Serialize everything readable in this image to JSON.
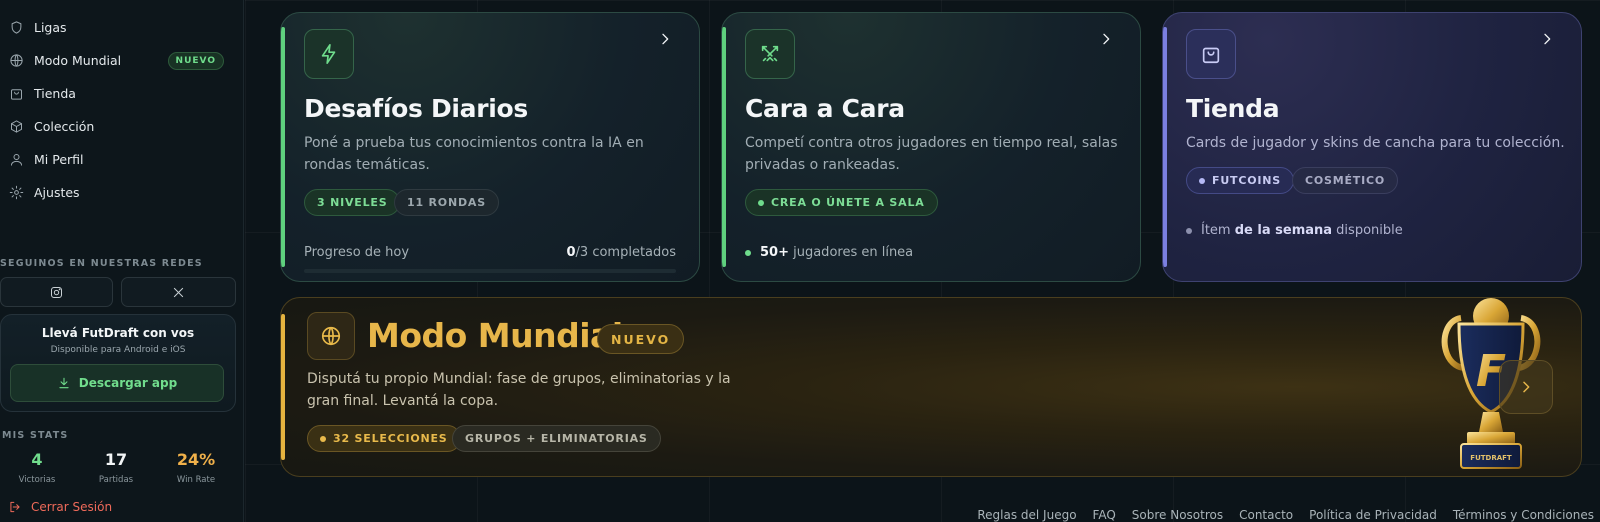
{
  "sidebar": {
    "items": [
      {
        "label": "Ligas",
        "icon": "shield-icon"
      },
      {
        "label": "Modo Mundial",
        "icon": "globe-icon",
        "badge": "NUEVO"
      },
      {
        "label": "Tienda",
        "icon": "shopping-bag-icon"
      },
      {
        "label": "Colección",
        "icon": "box-icon"
      },
      {
        "label": "Mi Perfil",
        "icon": "user-icon"
      },
      {
        "label": "Ajustes",
        "icon": "gear-icon"
      }
    ],
    "social_title": "SEGUINOS EN NUESTRAS REDES",
    "app_card": {
      "title": "Llevá FutDraft con vos",
      "subtitle": "Disponible para Android e iOS",
      "button": "Descargar app"
    },
    "stats_title": "MIS STATS",
    "stats": [
      {
        "value": "4",
        "label": "Victorias",
        "color": "#71dd8d"
      },
      {
        "value": "17",
        "label": "Partidas",
        "color": "#f2f5f6"
      },
      {
        "value": "24%",
        "label": "Win Rate",
        "color": "#efb04a"
      }
    ],
    "logout": "Cerrar Sesión"
  },
  "cards": {
    "desafios": {
      "title": "Desafíos Diarios",
      "desc": "Poné a prueba tus conocimientos contra la IA en rondas temáticas.",
      "pill1": "3 NIVELES",
      "pill2": "11 RONDAS",
      "progress_label": "Progreso de hoy",
      "progress_done": "0",
      "progress_rest": "/3 completados",
      "progress_fraction": 0
    },
    "cara": {
      "title": "Cara a Cara",
      "desc": "Competí contra otros jugadores en tiempo real, salas privadas o rankeadas.",
      "pill1": "CREA O ÚNETE A SALA",
      "online_count": "50+",
      "online_text": " jugadores en línea"
    },
    "tienda": {
      "title": "Tienda",
      "desc": "Cards de jugador y skins de cancha para tu colección.",
      "pill1": "FUTCOINS",
      "pill2": "COSMÉTICO",
      "line_a": "Ítem ",
      "line_b": "de la semana",
      "line_c": " disponible"
    }
  },
  "banner": {
    "title": "Modo Mundial",
    "badge": "NUEVO",
    "desc": "Disputá tu propio Mundial: fase de grupos, eliminatorias y la gran final. Levantá la copa.",
    "pill1": "32 SELECCIONES",
    "pill2": "GRUPOS + ELIMINATORIAS",
    "trophy_letter": "F",
    "trophy_plate": "FUTDRAFT"
  },
  "footer_links": [
    "Reglas del Juego",
    "FAQ",
    "Sobre Nosotros",
    "Contacto",
    "Política de Privacidad",
    "Términos y Condiciones"
  ],
  "colors": {
    "accent_green": "#6fdc8c",
    "accent_purple": "#7b7fe0",
    "accent_gold": "#e5b33f",
    "danger": "#ef6a5a"
  }
}
